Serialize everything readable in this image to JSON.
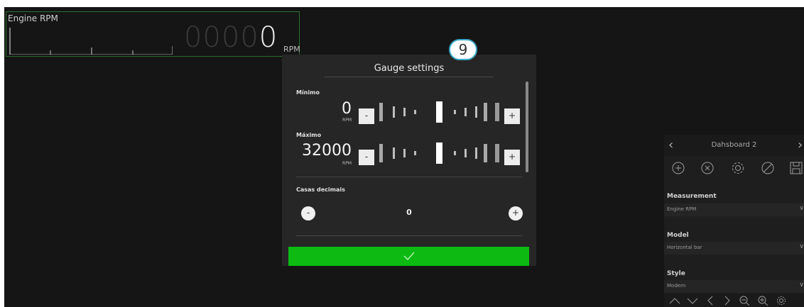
{
  "gauge": {
    "title": "Engine RPM",
    "value_dim": "0000",
    "value_lit": "0",
    "unit": "RPM"
  },
  "modal": {
    "badge": "9",
    "title": "Gauge settings",
    "minimum": {
      "label": "Mínimo",
      "value": "0",
      "unit": "RPM",
      "minus": "-",
      "plus": "+"
    },
    "maximum": {
      "label": "Máximo",
      "value": "32000",
      "unit": "RPM",
      "minus": "-",
      "plus": "+"
    },
    "decimals": {
      "label": "Casas decimais",
      "value": "0",
      "minus": "-",
      "plus": "+"
    },
    "confirm_icon": "checkmark-icon"
  },
  "panel": {
    "title": "Dahsboard 2",
    "prev_icon": "chevron-left-icon",
    "next_icon": "chevron-right-icon",
    "tools": [
      "add-circle-icon",
      "close-circle-icon",
      "gear-icon",
      "disabled-icon",
      "save-icon"
    ],
    "fields": [
      {
        "label": "Measurement",
        "value": "Engine RPM"
      },
      {
        "label": "Model",
        "value": "Horizontal bar"
      },
      {
        "label": "Style",
        "value": "Modern"
      }
    ],
    "bottom_icons": [
      "chevron-up-icon",
      "chevron-down-icon",
      "chevron-left-icon",
      "chevron-right-icon",
      "zoom-out-icon",
      "zoom-in-icon",
      "gear-icon"
    ]
  },
  "colors": {
    "background": "#151515",
    "modal": "#262626",
    "confirm": "#0cba12",
    "badge_border": "#3aa9c9",
    "gauge_border": "#2f6f2f"
  }
}
